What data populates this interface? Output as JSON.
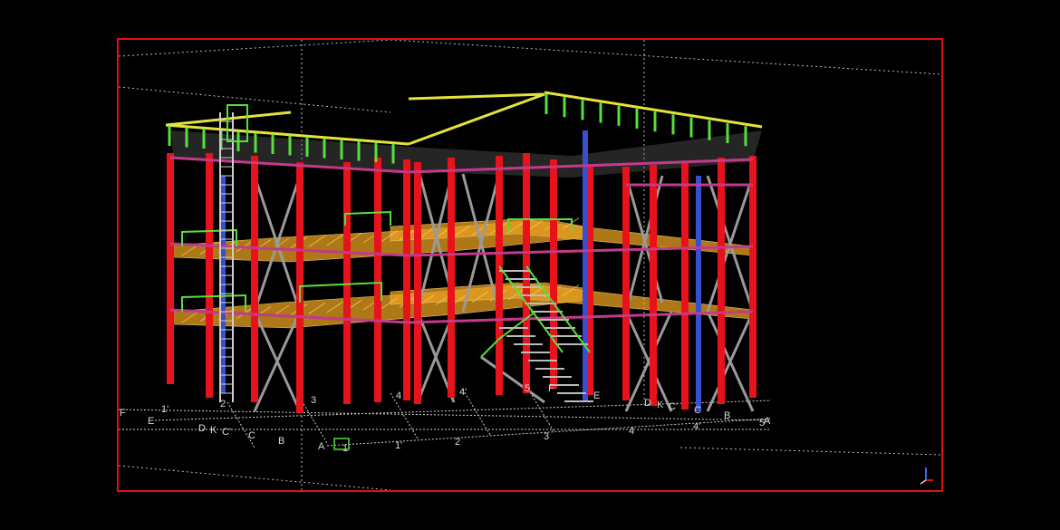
{
  "viewport": {
    "border_color": "#e01010",
    "background": "#000000"
  },
  "colors": {
    "column": "#e8121c",
    "bracing": "#9a9a9a",
    "edge_beam": "#3a4fd0",
    "handrail": "#56e03a",
    "top_rail": "#e6e23c",
    "grating": "#e8a020",
    "grid_line": "#cfcfcf"
  },
  "grid_labels": {
    "rear_row": [
      "1'",
      "2",
      "3",
      "4",
      "4'",
      "5",
      "F",
      "E",
      "D",
      "K",
      "C'",
      "C"
    ],
    "left_row": [
      "F",
      "E",
      "D",
      "K",
      "C'",
      "C",
      "B",
      "A"
    ],
    "front_row": [
      "1",
      "1'",
      "2",
      "3",
      "4",
      "4'",
      "5"
    ],
    "right_row": [
      "B",
      "A"
    ]
  },
  "axis_triad": {
    "z_color": "#3a6cf0",
    "x_color": "#e01010"
  }
}
